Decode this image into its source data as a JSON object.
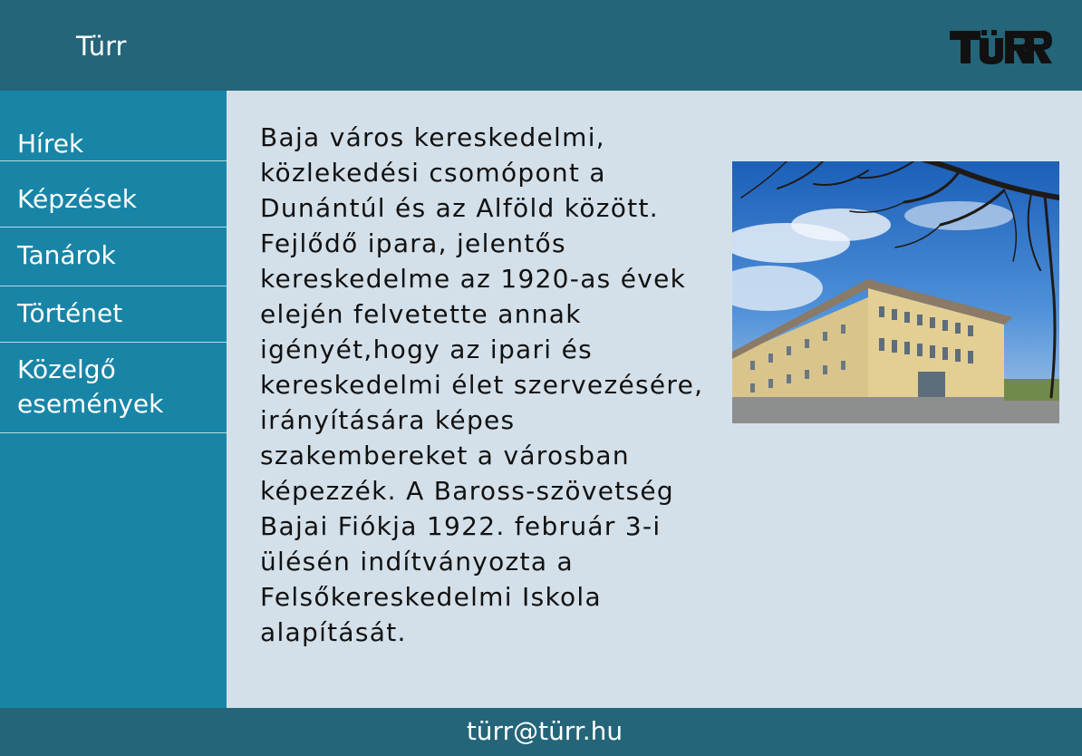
{
  "header": {
    "title": "Türr",
    "logo_text": "TÜRR"
  },
  "sidebar": {
    "items": [
      {
        "label": "Hírek"
      },
      {
        "label": "Képzések"
      },
      {
        "label": "Tanárok"
      },
      {
        "label": "Történet"
      },
      {
        "label": "Közelgő események"
      }
    ]
  },
  "main": {
    "article_text": "Baja város kereskedelmi, közlekedési csomópont a Dunántúl és az Alföld között. Fejlődő ipara, jelentős kereskedelme az 1920-as évek elején felvetette annak igényét,hogy az ipari és kereskedelmi élet szervezésére, irányítására képes szakembereket a városban képezzék. A Baross-szövetség Bajai Fiókja 1922. február 3-i ülésén indítványozta a Felsőkereskedelmi Iskola alapítását."
  },
  "footer": {
    "email": "türr@türr.hu"
  },
  "colors": {
    "header_bg": "#246579",
    "sidebar_bg": "#1885a7",
    "main_bg": "#d4e0e9",
    "footer_bg": "#246579"
  }
}
